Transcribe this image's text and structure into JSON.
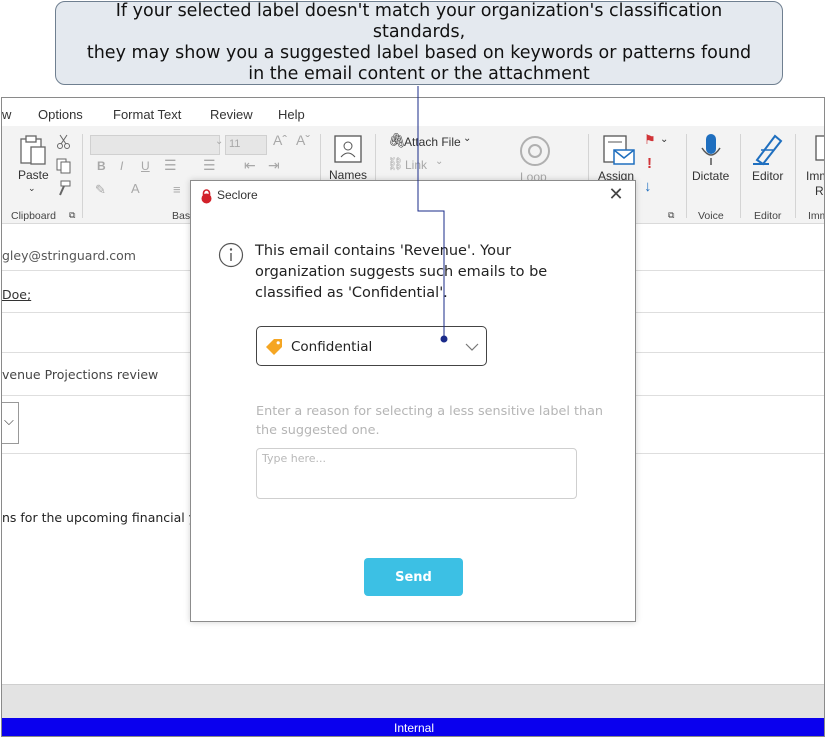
{
  "callout": {
    "text": "If your selected label doesn't match your organization's classification standards,\nthey may show you a suggested label based on keywords or patterns found\nin the email content or the attachment"
  },
  "ribbon": {
    "tabs": [
      "w",
      "Options",
      "Format Text",
      "Review",
      "Help"
    ],
    "paste_label": "Paste",
    "font_size": "11",
    "attach_file_label": "Attach File",
    "link_label": "Link",
    "names_label": "Names",
    "loop_label": "Loop",
    "assign_label": "Assign",
    "dictate_label": "Dictate",
    "editor_label": "Editor",
    "immersive_label_1": "Imm",
    "immersive_label_2": "Re",
    "groups": {
      "clipboard": "Clipboard",
      "basic_text": "Basi",
      "voice": "Voice",
      "editor": "Editor",
      "immersive": "Imm"
    }
  },
  "compose": {
    "from_text": "gley@stringuard.com",
    "to_text": "Doe;",
    "subject_text": "venue Projections review",
    "body_text": "ns for the upcoming financial ye"
  },
  "status_bar": {
    "label": "Internal"
  },
  "dialog": {
    "title": "Seclore",
    "close_symbol": "✕",
    "message": "This email contains 'Revenue'. Your organization suggests such emails to be classified as 'Confidential'.",
    "selected_label": "Confidential",
    "reason_label": "Enter a reason for selecting a less sensitive label than the suggested one.",
    "reason_placeholder": "Type here...",
    "send_label": "Send"
  },
  "colors": {
    "accent_send": "#3cc0e4",
    "label_tag": "#f5a623",
    "status_bar": "#0a00ee",
    "seclore_red": "#d2212a",
    "connector": "#1a2b8a"
  }
}
